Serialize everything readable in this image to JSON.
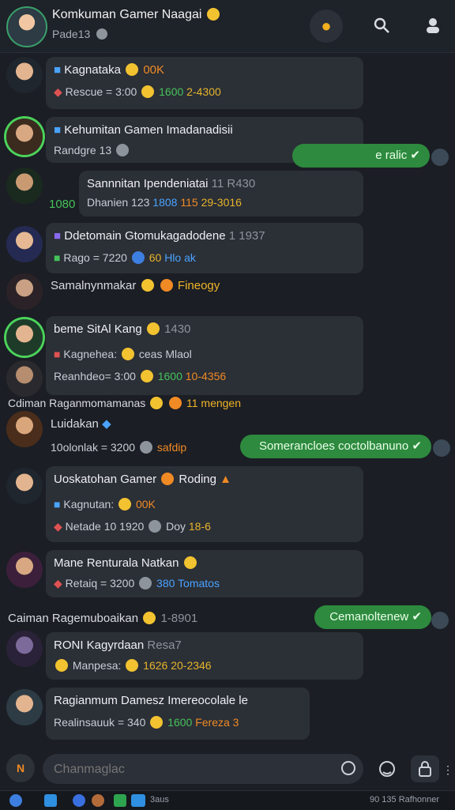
{
  "header": {
    "title": "Komkuman Gamer Naagai",
    "subtitle": "Pade13",
    "icons": [
      "gold-badge-icon",
      "search-icon",
      "profile-icon"
    ]
  },
  "messages": [
    {
      "line1": "Kagnataka",
      "tag1": "00K",
      "line2": "Rescue = 3:00",
      "num1": "1600",
      "num2": "2-4300"
    },
    {
      "line1": "Kehumitan Gamen Imadanadisii",
      "line2": "Randgre 13"
    },
    {
      "line1": "Sannnitan Ipendeniatai",
      "extra1": "11 R430",
      "line2prefix": "1080",
      "line2": "Dhanien 123",
      "num1": "1808",
      "num2": "115",
      "num3": "29-3016"
    },
    {
      "line1": "Ddetomain Gtomukagadodene",
      "extra1": "1 1937",
      "line2": "Rago = 7220",
      "num1": "60",
      "num2": "Hlo ak"
    },
    {
      "line1": "Samalnynmakar",
      "tag1": "Fineogy"
    },
    {
      "line1": "beme SitAl Kang",
      "extra1": "1430",
      "line2": "Kagnehea:",
      "tag2": "ceas Mlaol"
    },
    {
      "line1": "Reanhdeo= 3:00",
      "num1": "1600",
      "num2": "10-4356"
    },
    {
      "line1": "Cdiman Raganmomamanas",
      "extra1": "11 mengen"
    },
    {
      "line1": "Luidakan",
      "line2": "10olonlak = 3200",
      "tag2": "safdip"
    },
    {
      "line1": "Uoskatohan Gamer",
      "tag1": "Roding",
      "line2": "Kagnutan:",
      "tag2": "00K",
      "line3": "Netade 10 1920",
      "num1": "Doy",
      "num2": "18-6"
    },
    {
      "line1": "Mane Renturala Natkan",
      "line2": "Retaiq = 3200",
      "num1": "380",
      "num2": "Tomatos"
    },
    {
      "line1": "Caiman Ragemuboaikan",
      "extra1": "1-8901"
    },
    {
      "line1": "RONI Kagyrdaan",
      "extra1": "Resa7",
      "line2": "Manpesa:",
      "num1": "1626",
      "num2": "20-2346"
    },
    {
      "line1": "Ragianmum Damesz Imereocolale le",
      "line2": "Realinsauuk = 340",
      "num1": "1600",
      "num2": "Fereza",
      "num3": "3"
    }
  ],
  "outgoing": [
    {
      "text": "e ralic"
    },
    {
      "text": "Somerancloes coctolbanuno"
    },
    {
      "text": "Cemanoltenew"
    }
  ],
  "input": {
    "placeholder": "Chanmaglac"
  },
  "taskbar": {
    "left_label": "3aus",
    "right_label": "90 135 Rafhonner"
  }
}
